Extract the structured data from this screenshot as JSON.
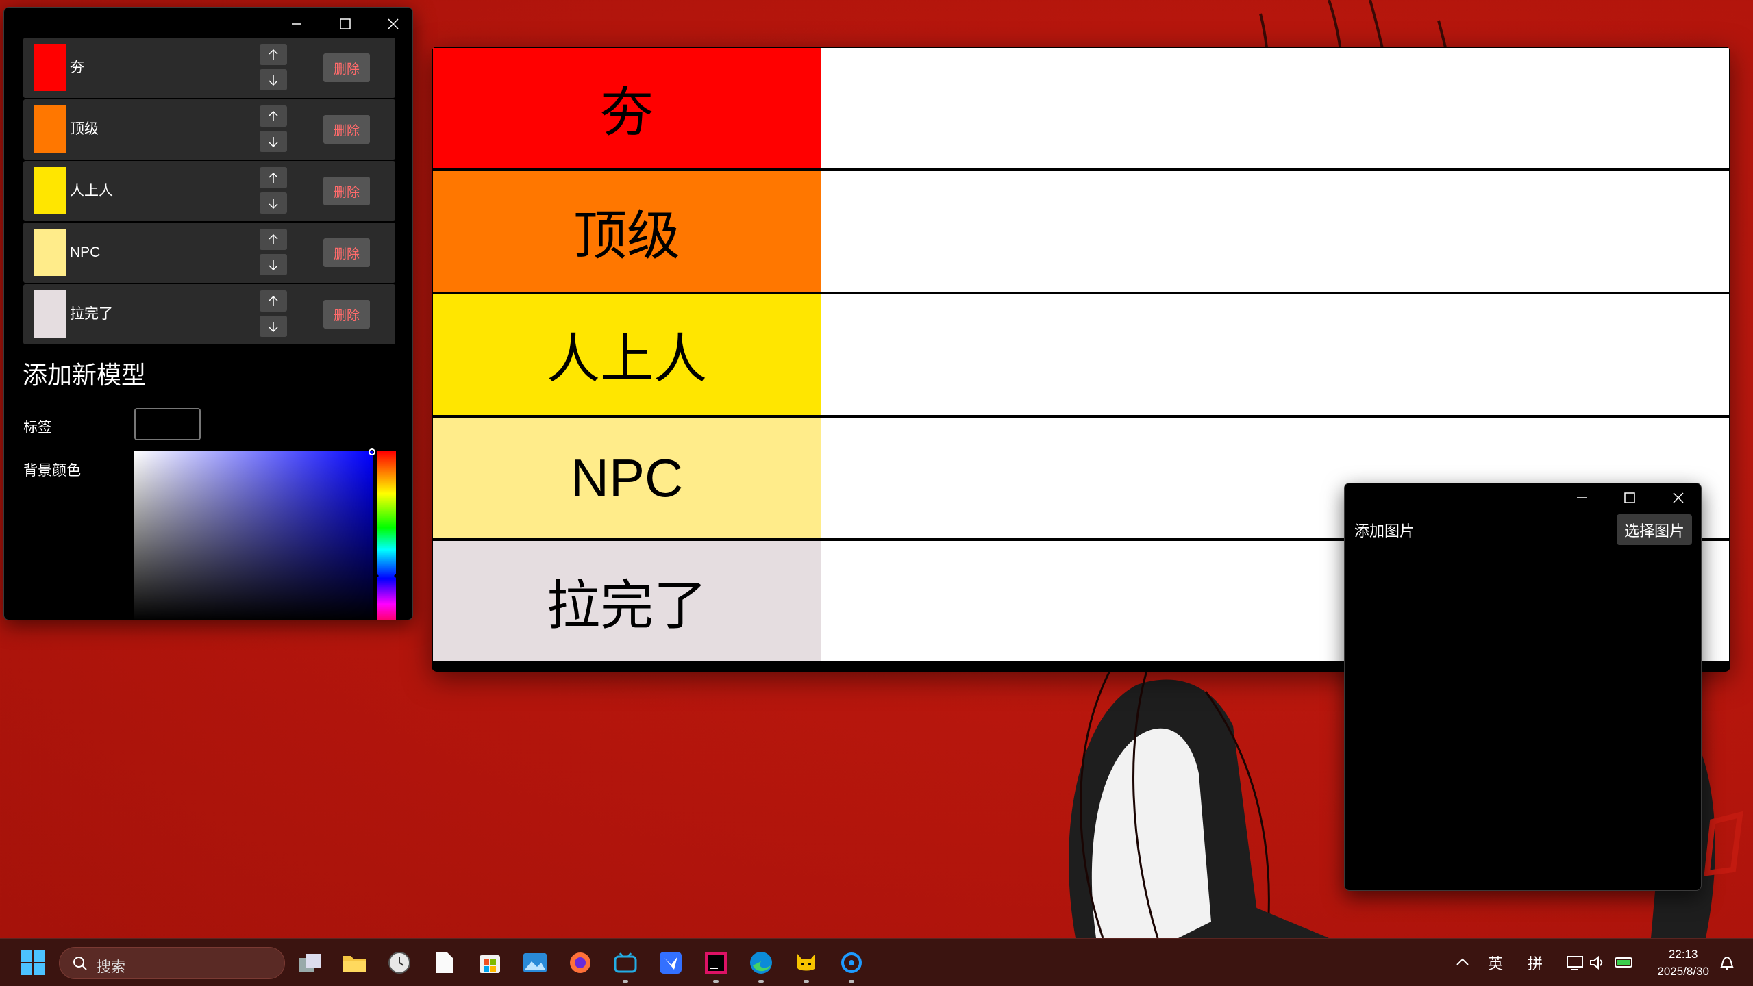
{
  "editor": {
    "tiers": [
      {
        "label": "夯",
        "color": "#ff0000",
        "delete_label": "删除"
      },
      {
        "label": "顶级",
        "color": "#ff7700",
        "delete_label": "删除"
      },
      {
        "label": "人上人",
        "color": "#ffe600",
        "delete_label": "删除"
      },
      {
        "label": "NPC",
        "color": "#ffec8a",
        "delete_label": "删除"
      },
      {
        "label": "拉完了",
        "color": "#e5dde0",
        "delete_label": "删除"
      }
    ],
    "section_title": "添加新模型",
    "label_field": "标签",
    "label_value": "",
    "color_field": "背景颜色"
  },
  "tier_list": {
    "rows": [
      {
        "label": "夯",
        "color": "#ff0000"
      },
      {
        "label": "顶级",
        "color": "#ff7700"
      },
      {
        "label": "人上人",
        "color": "#ffe600"
      },
      {
        "label": "NPC",
        "color": "#ffec8a"
      },
      {
        "label": "拉完了",
        "color": "#e5dde0"
      }
    ]
  },
  "image_dialog": {
    "title": "添加图片",
    "select_button": "选择图片"
  },
  "taskbar": {
    "search_placeholder": "搜索",
    "apps": [
      "task-view",
      "file-explorer",
      "clock-app",
      "notepad",
      "microsoft-store",
      "photos",
      "firefox",
      "bilibili",
      "feishu",
      "rider",
      "edge",
      "cat-app",
      "qq"
    ],
    "tray": {
      "input_lang": "英",
      "ime_mode": "拼",
      "time": "22:13",
      "date": "2025/8/30"
    }
  },
  "colors": {
    "desktop_red": "#b3150c",
    "taskbar_bg": "#3b1410"
  }
}
